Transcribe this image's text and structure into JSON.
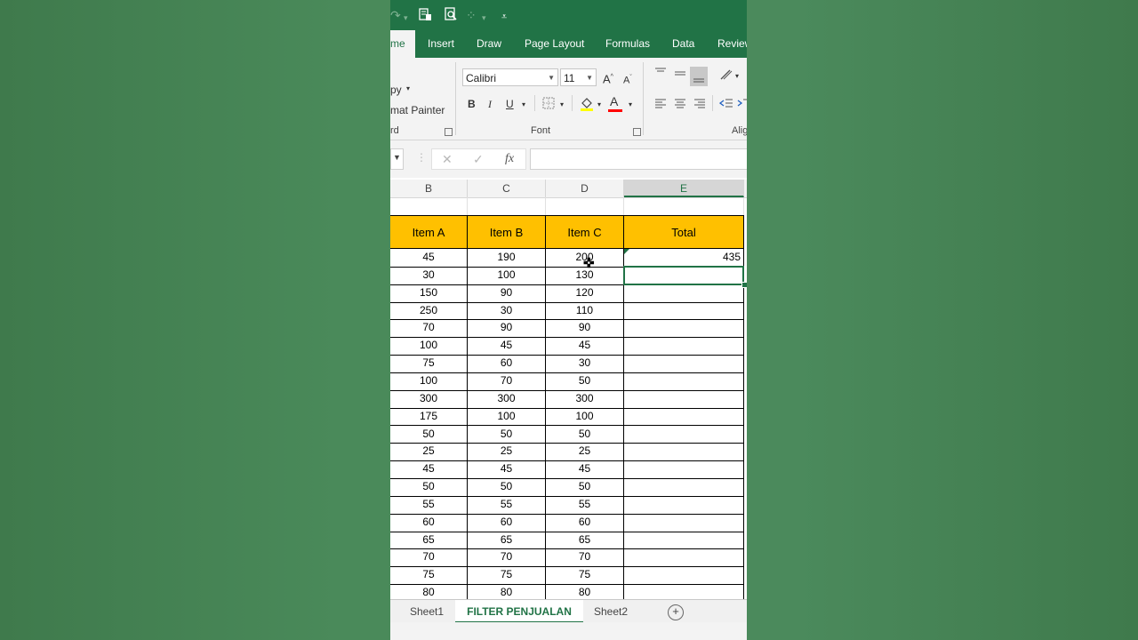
{
  "tabs": {
    "home": "me",
    "items": [
      "Insert",
      "Draw",
      "Page Layout",
      "Formulas",
      "Data",
      "Review"
    ]
  },
  "clipboard": {
    "copy": "py",
    "format_painter": "mat Painter",
    "group_label": "rd"
  },
  "font": {
    "name": "Calibri",
    "size": "11",
    "bold": "B",
    "italic": "I",
    "underline": "U",
    "font_color": "A",
    "group_label": "Font"
  },
  "alignment": {
    "group_label": "Alig"
  },
  "formula_bar": {
    "fx": "fx",
    "value": ""
  },
  "grid": {
    "columns": [
      "B",
      "C",
      "D",
      "E"
    ],
    "selected_column": "E",
    "headers": [
      "Item A",
      "Item B",
      "Item C",
      "Total"
    ],
    "rows": [
      [
        "45",
        "190",
        "200",
        "435"
      ],
      [
        "30",
        "100",
        "130",
        ""
      ],
      [
        "150",
        "90",
        "120",
        ""
      ],
      [
        "250",
        "30",
        "110",
        ""
      ],
      [
        "70",
        "90",
        "90",
        ""
      ],
      [
        "100",
        "45",
        "45",
        ""
      ],
      [
        "75",
        "60",
        "30",
        ""
      ],
      [
        "100",
        "70",
        "50",
        ""
      ],
      [
        "300",
        "300",
        "300",
        ""
      ],
      [
        "175",
        "100",
        "100",
        ""
      ],
      [
        "50",
        "50",
        "50",
        ""
      ],
      [
        "25",
        "25",
        "25",
        ""
      ],
      [
        "45",
        "45",
        "45",
        ""
      ],
      [
        "50",
        "50",
        "50",
        ""
      ],
      [
        "55",
        "55",
        "55",
        ""
      ],
      [
        "60",
        "60",
        "60",
        ""
      ],
      [
        "65",
        "65",
        "65",
        ""
      ],
      [
        "70",
        "70",
        "70",
        ""
      ],
      [
        "75",
        "75",
        "75",
        ""
      ],
      [
        "80",
        "80",
        "80",
        ""
      ]
    ]
  },
  "sheets": {
    "tabs": [
      "Sheet1",
      "FILTER PENJUALAN",
      "Sheet2"
    ],
    "active": "FILTER PENJUALAN",
    "add": "+"
  },
  "colors": {
    "excel_green": "#217346",
    "header_fill": "#ffc000",
    "selection": "#217346"
  }
}
